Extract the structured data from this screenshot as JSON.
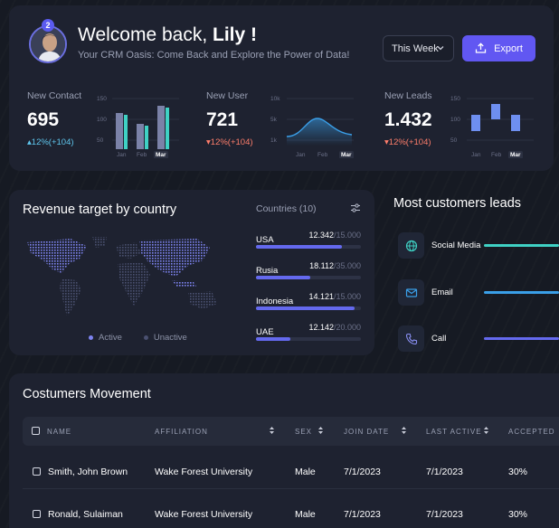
{
  "header": {
    "notification_count": "2",
    "welcome_prefix": "Welcome back,",
    "user_name": "Lily !",
    "subtitle": "Your CRM Oasis: Come Back and Explore the Power of Data!",
    "period_label": "This Week",
    "export_label": "Export",
    "accent_color": "#6157f2"
  },
  "stats": [
    {
      "label": "New Contact",
      "value": "695",
      "change": "12%(+104)",
      "trend": "up"
    },
    {
      "label": "New User",
      "value": "721",
      "change": "12%(+104)",
      "trend": "down"
    },
    {
      "label": "New Leads",
      "value": "1.432",
      "change": "12%(+104)",
      "trend": "down"
    }
  ],
  "mini_charts": {
    "contact": {
      "type": "bar",
      "y_ticks": [
        "150",
        "100",
        "50"
      ],
      "x": [
        "Jan",
        "Feb",
        "Mar"
      ],
      "values": [
        [
          125,
          110
        ],
        [
          100,
          95
        ],
        [
          145,
          140
        ]
      ]
    },
    "user": {
      "type": "area",
      "y_ticks": [
        "10k",
        "5k",
        "1k"
      ],
      "x": [
        "Jan",
        "Feb",
        "Mar"
      ]
    },
    "leads": {
      "type": "floating-bar",
      "y_ticks": [
        "150",
        "100",
        "50"
      ],
      "x": [
        "Jan",
        "Feb",
        "Mar"
      ]
    }
  },
  "revenue": {
    "title": "Revenue target by country",
    "countries_header": "Countries (10)",
    "legend_active": "Active",
    "legend_unactive": "Unactive",
    "countries": [
      {
        "name": "USA",
        "value": "12.342",
        "target": "/15.000",
        "progress": 0.82
      },
      {
        "name": "Rusia",
        "value": "18.112",
        "target": "/35.000",
        "progress": 0.52
      },
      {
        "name": "Indonesia",
        "value": "14.121",
        "target": "/15.000",
        "progress": 0.94
      },
      {
        "name": "UAE",
        "value": "12.142",
        "target": "/20.000",
        "progress": 0.33
      }
    ]
  },
  "leads": {
    "title": "Most customers leads",
    "items": [
      {
        "name": "Social Media",
        "icon": "globe-icon",
        "color": "#3fd1c4"
      },
      {
        "name": "Email",
        "icon": "mail-icon",
        "color": "#3a9fe8"
      },
      {
        "name": "Call",
        "icon": "phone-icon",
        "color": "#6469ee"
      }
    ]
  },
  "movement": {
    "title": "Costumers Movement",
    "columns": [
      "NAME",
      "AFFILIATION",
      "SEX",
      "JOIN DATE",
      "LAST ACTIVE",
      "ACCEPTED"
    ],
    "rows": [
      [
        "Smith, John Brown",
        "Wake Forest University",
        "Male",
        "7/1/2023",
        "7/1/2023",
        "30%"
      ],
      [
        "Ronald, Sulaiman",
        "Wake Forest University",
        "Male",
        "7/1/2023",
        "7/1/2023",
        "30%"
      ]
    ]
  }
}
